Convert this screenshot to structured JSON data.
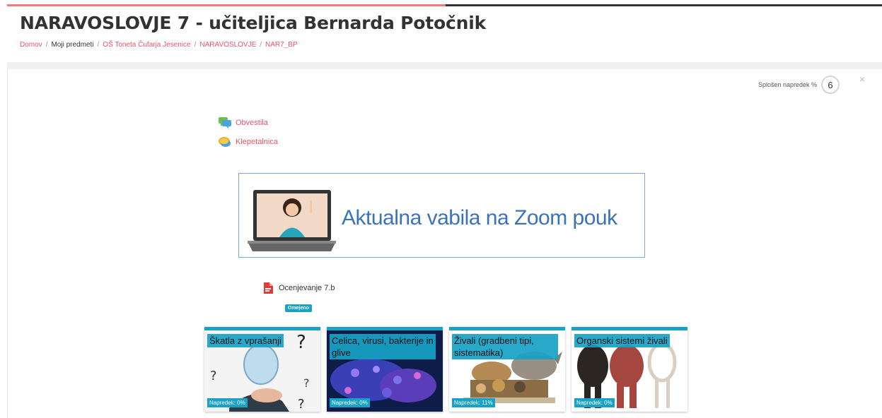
{
  "page": {
    "title": "NARAVOSLOVJE 7 - učiteljica Bernarda Potočnik"
  },
  "breadcrumb": [
    {
      "label": "Domov",
      "link": true
    },
    {
      "label": "Moji predmeti",
      "link": false
    },
    {
      "label": "OŠ Toneta Čufarja Jesenice",
      "link": true
    },
    {
      "label": "NARAVOSLOVJE",
      "link": true
    },
    {
      "label": "NAR7_BP",
      "link": true
    }
  ],
  "progress": {
    "label": "Splošen napredek %",
    "value": "6"
  },
  "close_icon": "×",
  "activities": {
    "news": "Obvestila",
    "chat": "Klepetalnica"
  },
  "banner": {
    "text": "Aktualna vabila na Zoom pouk"
  },
  "file": {
    "name": "Ocenjevanje 7.b",
    "badge": "Omejeno"
  },
  "tiles": [
    {
      "title": "Škatla z vprašanji",
      "progress": "Napredek: 0%"
    },
    {
      "title": "Celica, virusi, bakterije in glive",
      "progress": "Napredek: 0%"
    },
    {
      "title": "Živali (gradbeni tipi, sistematika)",
      "progress": "Napredek: 11%"
    },
    {
      "title": "Organski sistemi živali",
      "progress": "Napredek: 0%"
    }
  ],
  "colors": {
    "accent": "#17a2c6",
    "link": "#e9546b",
    "banner_text": "#3b73b9"
  }
}
